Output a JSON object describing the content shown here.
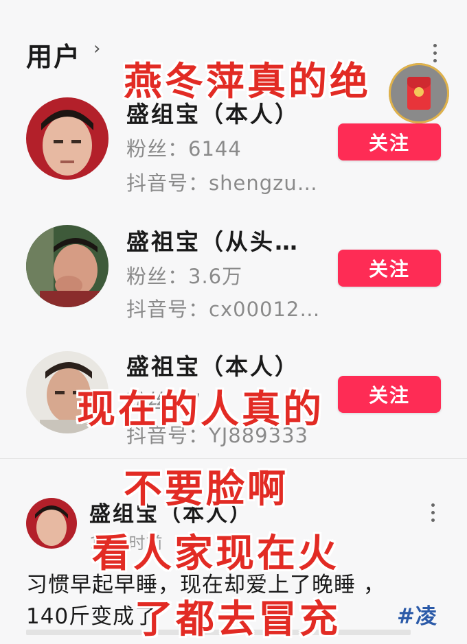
{
  "section": {
    "title": "用户"
  },
  "follow_label": "关注",
  "users": [
    {
      "name": "盛组宝（本人）",
      "fans_label": "粉丝：",
      "fans": "6144",
      "id_label": "抖音号：",
      "id": "shengzu…"
    },
    {
      "name": "盛祖宝（从头…",
      "fans_label": "粉丝：",
      "fans": "3.6万",
      "id_label": "抖音号：",
      "id": "cx00012…"
    },
    {
      "name": "盛祖宝（本人）",
      "fans_label": "粉丝：",
      "fans": "7",
      "id_label": "抖音号：",
      "id": "YJ889333"
    }
  ],
  "post": {
    "author": "盛组宝（本人）",
    "time": "14小时前",
    "line1": "习惯早起早睡，现在却爱上了晚睡 ，",
    "line2_prefix": "140斤变成了",
    "line2_hashtag": "#凌"
  },
  "overlays": [
    "燕冬萍真的绝",
    "现在的人真的",
    "不要脸啊",
    "看人家现在火",
    "了都去冒充"
  ]
}
